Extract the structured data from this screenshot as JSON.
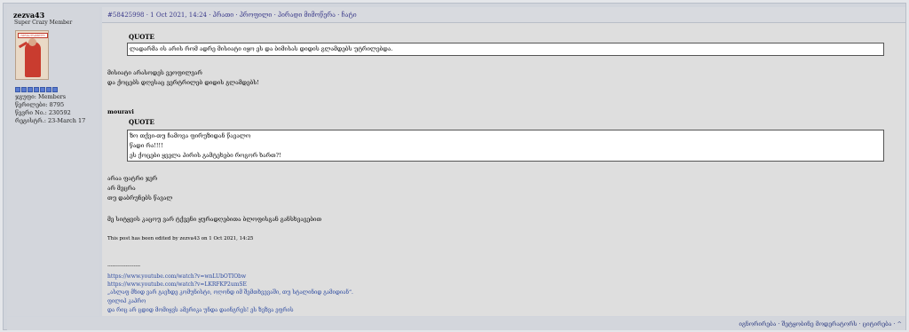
{
  "user": {
    "name": "zezva43",
    "rank": "Super Crazy Member",
    "avatar_caption": "ᲘᲔᲠᲕᲐ-ᲚᲐᲨᲕᲘᲚᲘ",
    "group": "ჯგუფი: Members",
    "posts": "წერილები: 8795",
    "member_no": "წევრი No.: 230592",
    "registered": "რეგისტრ.: 23-March 17"
  },
  "post": {
    "header": "#58425998 · 1 Oct 2021, 14:24 · პრათი · პროფილი · პირადი მიმოწერა · ჩატი",
    "quote1_label": "QUOTE",
    "quote1_text": "ლადარმა ის არის რომ ადრე მისიატი იყო ეს და ბიმისას დიდის გლამდებს უტრილებდა.",
    "body1_line1": "მისიატი არასოდეს ვეოფილვარ",
    "body1_line2": "და ქოცებს დღესაც ვერტრილებ დიდის გლამდებს!",
    "quoted_author": "mouravi",
    "quote2_label": "QUOTE",
    "quote2_lines": [
      "ზო თქვი-თუ ჩამოვა ფირუზიდან წავალო",
      "წადი რა!!!!",
      "ეს ქოცები ყველა პირის გამტეხები როგორ ხართ?!"
    ],
    "body2_lines": [
      "არაა ფატრი ჯერ",
      "არ მეცრა",
      "თუ დაბრუნებს წავალ"
    ],
    "body3": "მე სიტყვის კაცოუ ვარ ტქვენი ყურადღებითა ბლოფისგან განსხვავებით",
    "edited": "This post has been edited by zezva43 on 1 Oct 2021, 14:25",
    "sig_divider": "--------------------",
    "sig_links": [
      "https://www.youtube.com/watch?v=wnLUbOTIObw",
      "https://www.youtube.com/watch?v=LKRFKP2umSE",
      "„ასლაფ მხიდ ვარ გავხდე კომუნისტი, ოღონდ იმ შემთხვევაში, თუ სტალინიდ გამიდიან“.",
      "ფილიპ კაპრო",
      "და რიც არ ცდიდ მომიყვს ამერიკა უნდა დაინგრეს! ეს ზეზვა ეფრის"
    ]
  },
  "footer": {
    "links": "იგნორირება · შეტყობინე მოდერატორს · ციტირება · ^"
  }
}
